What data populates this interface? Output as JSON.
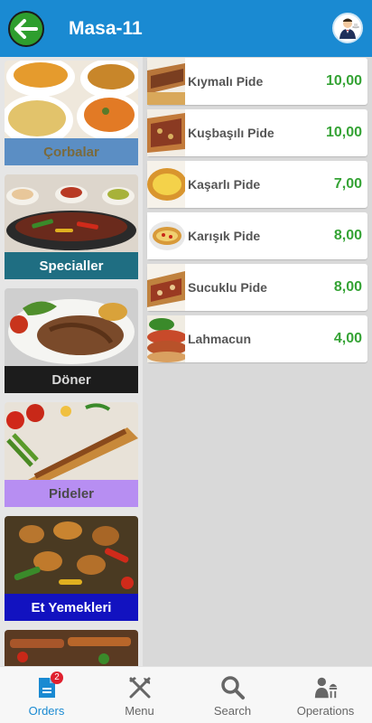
{
  "header": {
    "title": "Masa-11",
    "back_icon": "arrow-left-icon",
    "profile_icon": "waiter-icon"
  },
  "categories": [
    {
      "label": "Çorbalar",
      "bg": "#5b8ec4",
      "fg": "#7a6a3d"
    },
    {
      "label": "Specialler",
      "bg": "#1f6e82",
      "fg": "#ffffff"
    },
    {
      "label": "Döner",
      "bg": "#1c1c1c",
      "fg": "#d8d8d8"
    },
    {
      "label": "Pideler",
      "bg": "#b78ef2",
      "fg": "#4a4a4a"
    },
    {
      "label": "Et Yemekleri",
      "bg": "#1212c0",
      "fg": "#ffffff"
    }
  ],
  "products": [
    {
      "name": "Kıymalı Pide",
      "price": "10,00"
    },
    {
      "name": "Kuşbaşılı Pide",
      "price": "10,00"
    },
    {
      "name": "Kaşarlı Pide",
      "price": "7,00"
    },
    {
      "name": "Karışık Pide",
      "price": "8,00"
    },
    {
      "name": "Sucuklu Pide",
      "price": "8,00"
    },
    {
      "name": "Lahmacun",
      "price": "4,00"
    }
  ],
  "nav": {
    "orders": {
      "label": "Orders",
      "badge": "2",
      "icon": "document-icon"
    },
    "menu": {
      "label": "Menu",
      "icon": "fork-knife-icon"
    },
    "search": {
      "label": "Search",
      "icon": "search-icon"
    },
    "operations": {
      "label": "Operations",
      "icon": "operations-icon"
    }
  },
  "colors": {
    "header": "#1a8ad2",
    "price": "#35a335",
    "active": "#1a8ad2"
  }
}
